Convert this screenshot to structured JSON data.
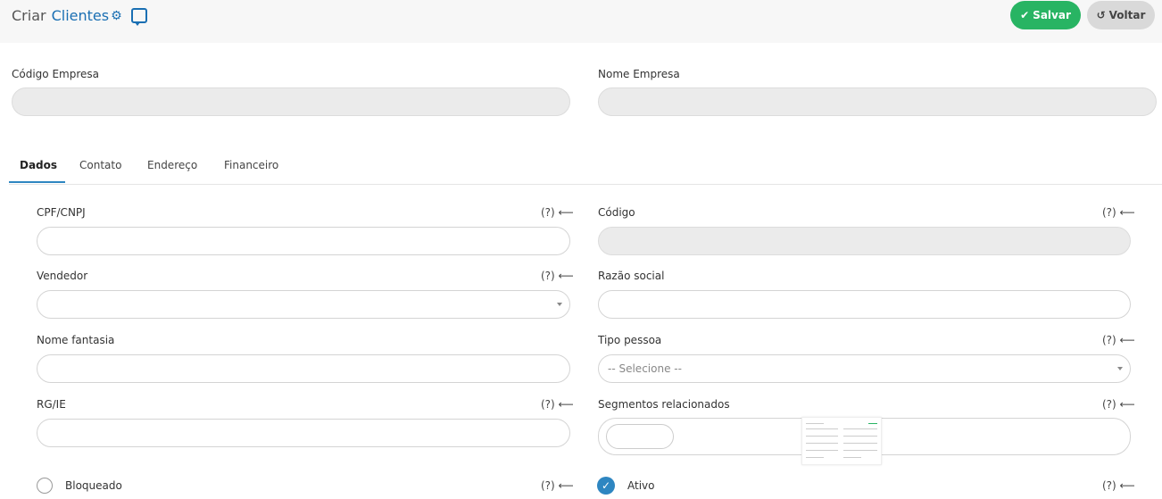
{
  "header": {
    "title_prefix": "Criar",
    "title_entity": "Clientes",
    "save_label": "Salvar",
    "back_label": "Voltar"
  },
  "company": {
    "code_label": "Código Empresa",
    "name_label": "Nome Empresa"
  },
  "tabs": [
    {
      "label": "Dados",
      "active": true
    },
    {
      "label": "Contato",
      "active": false
    },
    {
      "label": "Endereço",
      "active": false
    },
    {
      "label": "Financeiro",
      "active": false
    }
  ],
  "help_text": "(?) ⟵",
  "form": {
    "cpf_cnpj_label": "CPF/CNPJ",
    "codigo_label": "Código",
    "vendedor_label": "Vendedor",
    "razao_social_label": "Razão social",
    "nome_fantasia_label": "Nome fantasia",
    "tipo_pessoa_label": "Tipo pessoa",
    "tipo_pessoa_value": "-- Selecione --",
    "rg_ie_label": "RG/IE",
    "segmentos_label": "Segmentos relacionados",
    "bloqueado_label": "Bloqueado",
    "ativo_label": "Ativo"
  },
  "colors": {
    "accent": "#1a6fb3",
    "save": "#28b463",
    "check": "#2e86c1"
  }
}
